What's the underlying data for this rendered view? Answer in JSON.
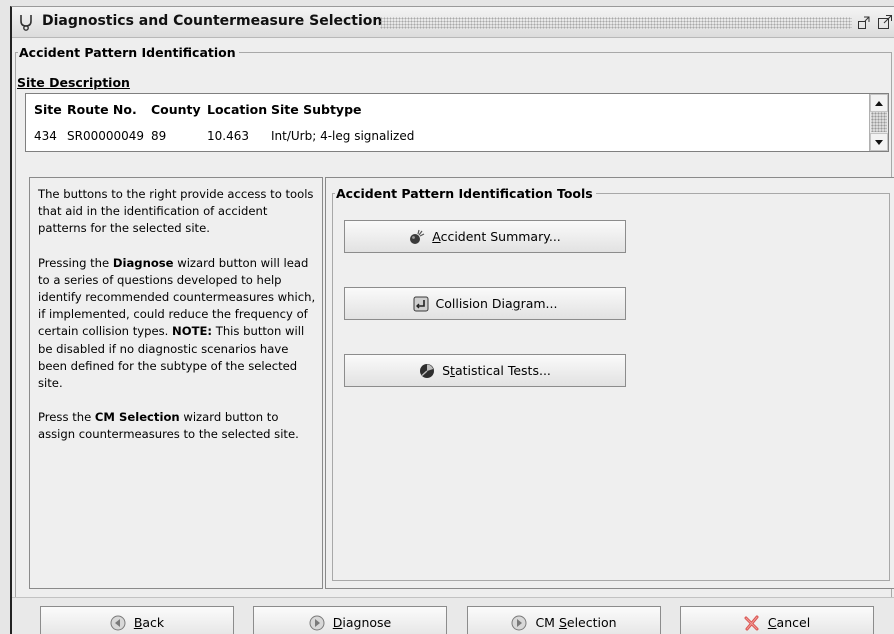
{
  "window": {
    "title": "Diagnostics and Countermeasure Selection",
    "icon": "stethoscope-icon"
  },
  "pattern_group": {
    "legend": "Accident Pattern Identification"
  },
  "site_description": {
    "label": "Site Description",
    "columns": [
      "Site",
      "Route No.",
      "County",
      "Location",
      "Site Subtype"
    ],
    "rows": [
      [
        "434",
        "SR00000049",
        "89",
        "10.463",
        "Int/Urb; 4-leg signalized"
      ]
    ]
  },
  "help_text": {
    "p1": "The buttons to the right provide access to tools that aid in the identification of accident patterns for the selected site.",
    "p2_pre": "Pressing the ",
    "p2_bold": "Diagnose",
    "p2_mid": " wizard button will lead to a series of questions developed to help identify recommended countermeasures which, if implemented, could reduce the frequency of certain collision types. ",
    "p2_note": "NOTE:",
    "p2_post": " This button will be disabled if no diagnostic scenarios have been defined for the subtype of the selected site.",
    "p3_pre": "Press the ",
    "p3_bold": "CM Selection",
    "p3_post": " wizard button to assign countermeasures to the selected site."
  },
  "tools": {
    "legend": "Accident Pattern Identification Tools",
    "accident_summary": {
      "mnemonic": "A",
      "rest": "ccident Summary..."
    },
    "collision_diagram": {
      "pre": "Collision Dia",
      "mnemonic": "g",
      "post": "ram..."
    },
    "statistical_tests": {
      "pre": "S",
      "mnemonic": "t",
      "post": "atistical Tests..."
    }
  },
  "nav": {
    "back": {
      "mnemonic": "B",
      "rest": "ack"
    },
    "diagnose": {
      "mnemonic": "D",
      "rest": "iagnose"
    },
    "cm_selection": {
      "pre": "CM ",
      "mnemonic": "S",
      "post": "election"
    },
    "cancel": {
      "mnemonic": "C",
      "rest": "ancel"
    }
  },
  "colors": {
    "accent_cancel": "#d9534f",
    "nav_icon": "#8a8a8a"
  }
}
